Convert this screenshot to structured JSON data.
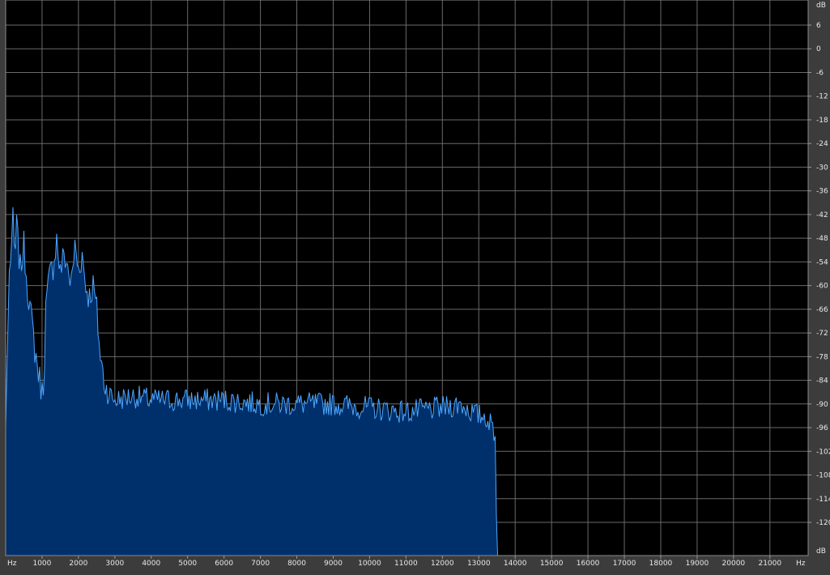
{
  "window": {
    "background": "#3c3c3c",
    "plot_background": "#000000",
    "grid_color": "#6a6a6a"
  },
  "chart_data": {
    "type": "area",
    "title": "",
    "xlabel": "Hz",
    "ylabel": "dB",
    "x_unit_label_left": "Hz",
    "x_unit_label_right": "Hz",
    "y_unit_label_top": "dB",
    "y_unit_label_bottom": "dB",
    "xlim": [
      0,
      22050
    ],
    "ylim": [
      -132,
      12
    ],
    "x_ticks": [
      1000,
      2000,
      3000,
      4000,
      5000,
      6000,
      7000,
      8000,
      9000,
      10000,
      11000,
      12000,
      13000,
      14000,
      15000,
      16000,
      17000,
      18000,
      19000,
      20000,
      21000
    ],
    "x_tick_labels": [
      "1000",
      "2000",
      "3000",
      "4000",
      "5000",
      "6000",
      "7000",
      "8000",
      "9000",
      "10000",
      "11000",
      "12000",
      "13000",
      "14000",
      "15000",
      "16000",
      "17000",
      "18000",
      "19000",
      "20000",
      "21000"
    ],
    "y_ticks": [
      6,
      0,
      -6,
      -12,
      -18,
      -24,
      -30,
      -36,
      -42,
      -48,
      -54,
      -60,
      -66,
      -72,
      -78,
      -84,
      -90,
      -96,
      -102,
      -108,
      -114,
      -120
    ],
    "y_tick_labels": [
      "6",
      "0",
      "-6",
      "-12",
      "-18",
      "-24",
      "-30",
      "-36",
      "-42",
      "-48",
      "-54",
      "-60",
      "-66",
      "-72",
      "-78",
      "-84",
      "-90",
      "-96",
      "-102",
      "-108",
      "-114",
      "-120"
    ],
    "grid": true,
    "fill_color": "#00306b",
    "line_color": "#4da6ff",
    "series": [
      {
        "x": [
          0,
          50,
          100,
          200,
          250,
          300,
          400,
          500,
          600,
          700,
          800,
          900,
          1000,
          1050,
          1100,
          1200,
          1300,
          1400,
          1500,
          1600,
          1700,
          1800,
          1900,
          2000,
          2100,
          2200,
          2300,
          2400,
          2500,
          2600,
          2700,
          2800,
          3000,
          3500,
          4000,
          5000,
          6000,
          7000,
          8000,
          9000,
          10000,
          11000,
          12000,
          12500,
          12800,
          13000,
          13200,
          13300,
          13400,
          13450,
          13500,
          13550
        ],
        "y": [
          -96,
          -75,
          -57,
          -44,
          -54,
          -45,
          -56,
          -50,
          -60,
          -68,
          -76,
          -82,
          -87,
          -84,
          -66,
          -58,
          -55,
          -48,
          -57,
          -52,
          -55,
          -60,
          -50,
          -56,
          -52,
          -60,
          -63,
          -60,
          -66,
          -78,
          -84,
          -87,
          -89,
          -88,
          -89,
          -89,
          -89,
          -90,
          -90,
          -90,
          -91,
          -92,
          -91,
          -90,
          -92,
          -93,
          -93,
          -95,
          -96,
          -98,
          -128,
          -135
        ]
      }
    ]
  }
}
